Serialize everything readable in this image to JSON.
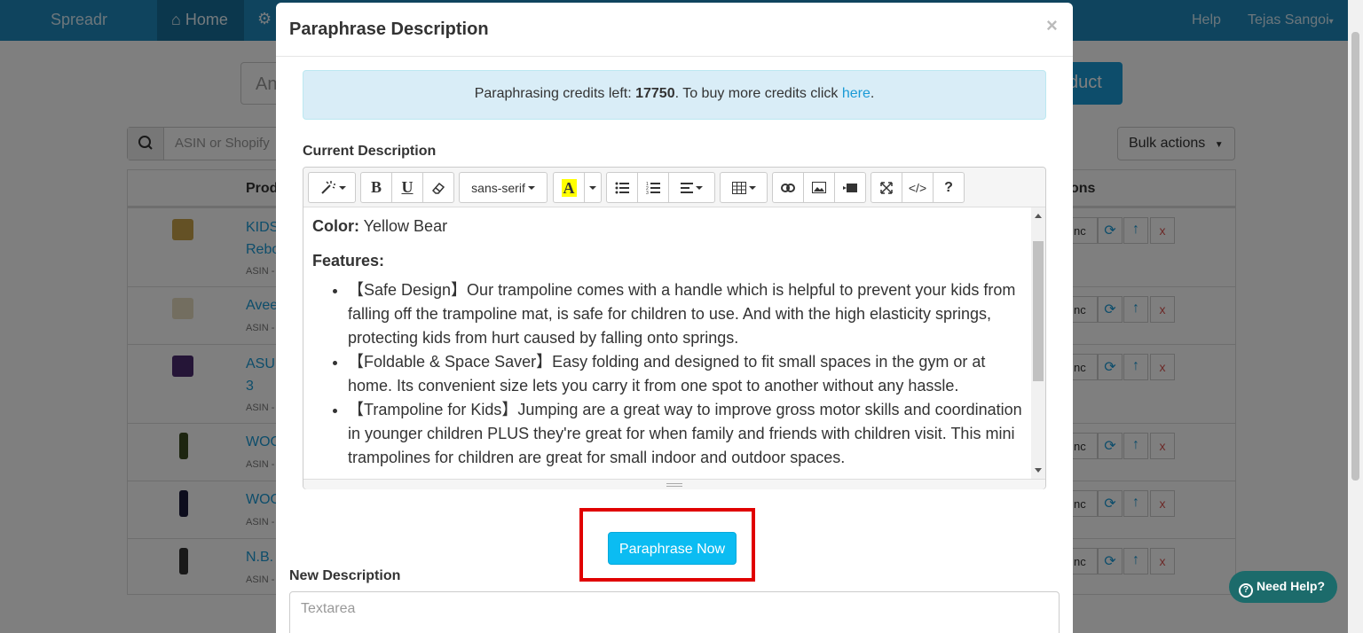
{
  "navbar": {
    "brand": "Spreadr",
    "home": "Home",
    "help": "Help",
    "user": "Tejas Sangoi"
  },
  "background": {
    "input_partial": "An",
    "add_partial": "duct",
    "search_placeholder": "ASIN or Shopify",
    "bulk_actions": "Bulk actions",
    "columns": [
      "Prod",
      "ons"
    ],
    "rows": [
      {
        "title": "KIDS\nRebo",
        "asin": "ASIN -"
      },
      {
        "title": "Avee",
        "asin": "ASIN -"
      },
      {
        "title": "ASU\n3",
        "asin": "ASIN -"
      },
      {
        "title": "WOO",
        "asin": "ASIN -"
      },
      {
        "title": "WOO",
        "asin": "ASIN -"
      },
      {
        "title": "N.B.",
        "asin": "ASIN -"
      }
    ],
    "sync_partial": "nc",
    "delete": "x"
  },
  "need_help": "Need Help?",
  "modal": {
    "title": "Paraphrase Description",
    "close": "×",
    "alert": {
      "prefix": "Paraphrasing credits left: ",
      "credits": "17750",
      "middle": ". To buy more credits click ",
      "link": "here",
      "suffix": "."
    },
    "current_label": "Current Description",
    "toolbar": {
      "font_name": "sans-serif",
      "bold": "B",
      "underline": "U",
      "color_letter": "A",
      "code": "</>",
      "help": "?"
    },
    "description": {
      "color_label": "Color:",
      "color_value": " Yellow Bear",
      "features_label": "Features:",
      "bullets": [
        "【Safe Design】Our trampoline comes with a handle which is helpful to prevent your kids from falling off the trampoline mat, is safe for children to use. And with the high elasticity springs, protecting kids from hurt caused by falling onto springs.",
        "【Foldable & Space Saver】Easy folding and designed to fit small spaces in the gym or at home. Its convenient size lets you carry it from one spot to another without any hassle.",
        "【Trampoline for Kids】Jumping are a great way to improve gross motor skills and coordination in younger children PLUS they're great for when family and friends with children visit. This mini trampolines for children are great for small indoor and outdoor spaces."
      ]
    },
    "paraphrase_button": "Paraphrase Now",
    "new_label": "New Description",
    "new_placeholder": "Textarea",
    "colors": {
      "primary": "#0bbcf2",
      "highlight": "#e00000",
      "navbar": "#1f88bd"
    }
  }
}
